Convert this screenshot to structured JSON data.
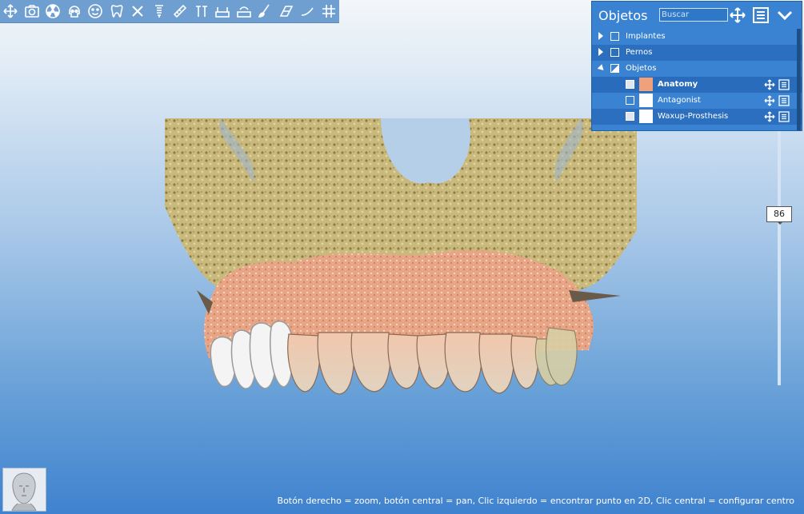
{
  "toolbar": {
    "icons": [
      "move-icon",
      "camera-icon",
      "radiation-icon",
      "skull-icon",
      "face-icon",
      "tooth-icon",
      "close-x-icon",
      "implant-icon",
      "ruler-icon",
      "pins-icon",
      "panoramic-icon",
      "panoramic-mark-icon",
      "brush-icon",
      "cut-plane-icon",
      "curve-icon",
      "grid-icon"
    ]
  },
  "panel": {
    "title": "Objetos",
    "search_placeholder": "Buscar",
    "items": [
      {
        "label": "Implantes",
        "level": 0,
        "expanded": false,
        "checked": false
      },
      {
        "label": "Pernos",
        "level": 0,
        "expanded": false,
        "checked": false
      },
      {
        "label": "Objetos",
        "level": 0,
        "expanded": true,
        "checked": "partial"
      },
      {
        "label": "Anatomy",
        "level": 1,
        "checked": true,
        "color": "#f0a07a"
      },
      {
        "label": "Antagonist",
        "level": 1,
        "checked": false,
        "color": "#ffffff"
      },
      {
        "label": "Waxup-Prosthesis",
        "level": 1,
        "checked": true,
        "color": "#ffffff"
      }
    ]
  },
  "slider": {
    "value": "86"
  },
  "status_hint": "Botón derecho = zoom, botón central = pan, Clic izquierdo = encontrar punto en 2D, Clic central = configurar centro",
  "colors": {
    "toolbar": "#6e9fd0",
    "panel": "#3a82d2",
    "bone": "#c8b77a",
    "gum": "#e8a888",
    "tooth": "#e6dccb"
  }
}
